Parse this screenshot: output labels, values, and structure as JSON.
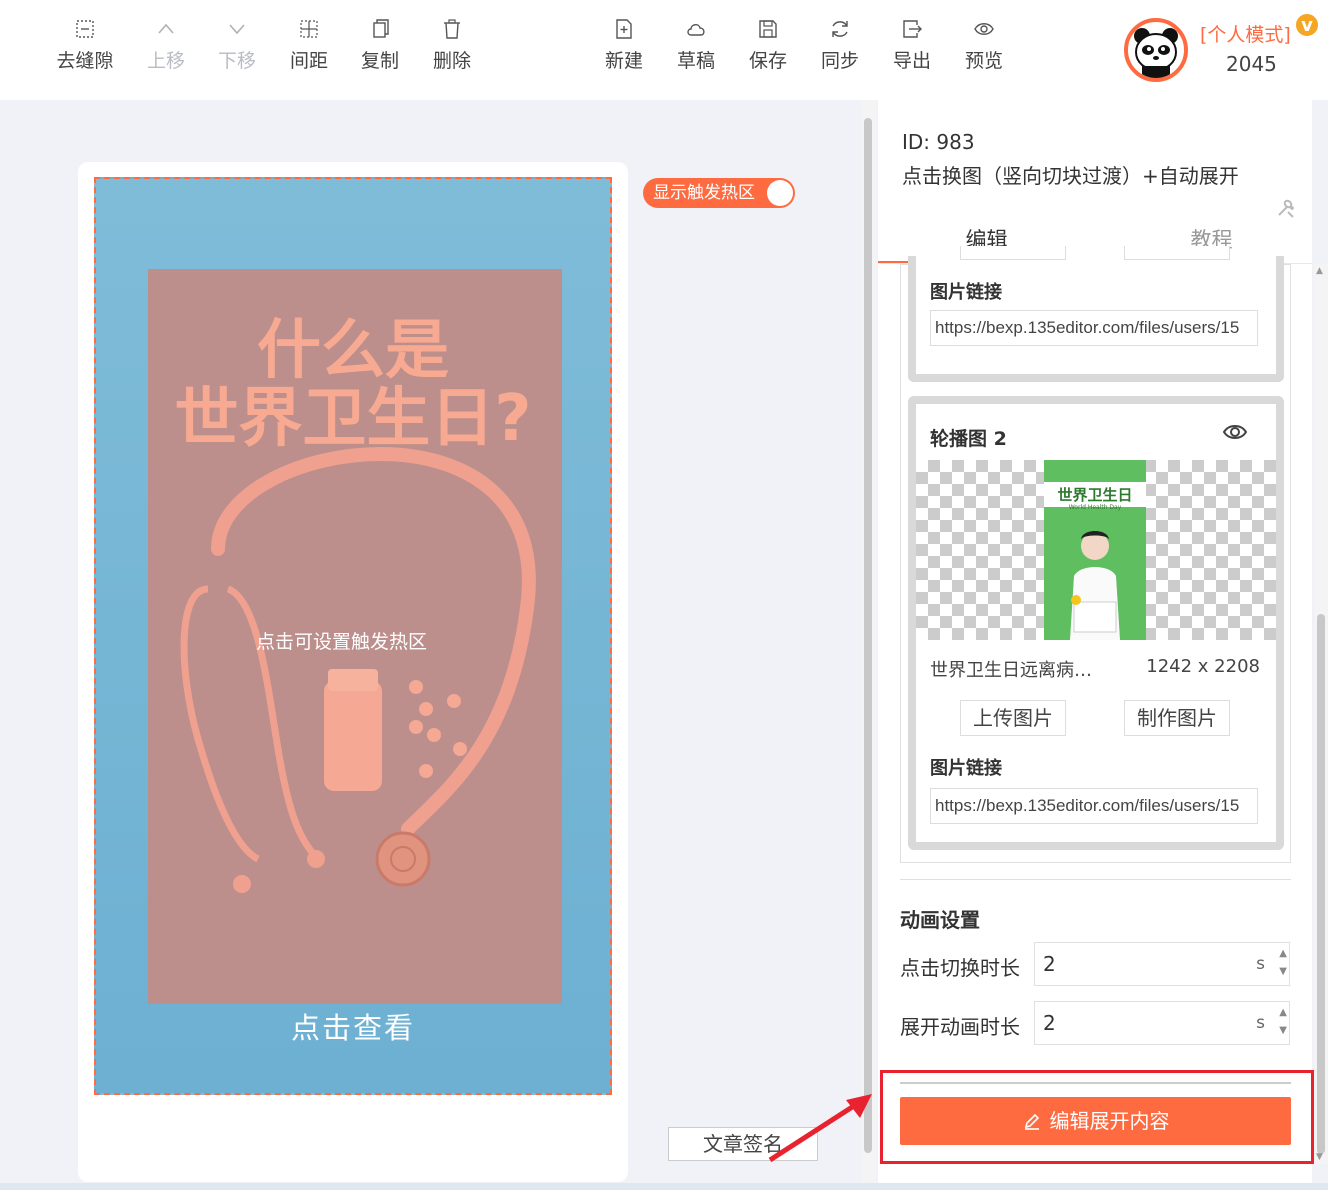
{
  "toolbar": {
    "left_group": [
      {
        "label": "去缝隙",
        "icon": "gap-icon",
        "disabled": false
      },
      {
        "label": "上移",
        "icon": "chevron-up-icon",
        "disabled": true
      },
      {
        "label": "下移",
        "icon": "chevron-down-icon",
        "disabled": true
      },
      {
        "label": "间距",
        "icon": "spacing-icon",
        "disabled": false
      },
      {
        "label": "复制",
        "icon": "copy-icon",
        "disabled": false
      },
      {
        "label": "删除",
        "icon": "trash-icon",
        "disabled": false
      }
    ],
    "right_group": [
      {
        "label": "新建",
        "icon": "new-file-icon"
      },
      {
        "label": "草稿",
        "icon": "cloud-icon"
      },
      {
        "label": "保存",
        "icon": "save-icon"
      },
      {
        "label": "同步",
        "icon": "sync-icon"
      },
      {
        "label": "导出",
        "icon": "export-icon"
      },
      {
        "label": "预览",
        "icon": "eye-icon"
      }
    ]
  },
  "user": {
    "mode": "[个人模式]",
    "vip_badge": "v",
    "id": "2045"
  },
  "canvas": {
    "toggle_label": "显示触发热区",
    "title_line1": "什么是",
    "title_line2": "世界卫生日?",
    "hotzone_hint": "点击可设置触发热区",
    "see_more": "点击查看",
    "signature": "文章签名"
  },
  "panel": {
    "id_label": "ID: 983",
    "component_name": "点击换图（竖向切块过渡）+自动展开",
    "tabs": [
      "编辑",
      "教程"
    ],
    "slide1": {
      "link_label": "图片链接",
      "link_value": "https://bexp.135editor.com/files/users/15"
    },
    "slide2": {
      "title": "轮播图 2",
      "thumb_title": "世界卫生日",
      "thumb_sub": "World Health Day",
      "file_name": "世界卫生日远离病…",
      "dimensions": "1242 x 2208",
      "upload_button": "上传图片",
      "make_button": "制作图片",
      "link_label": "图片链接",
      "link_value": "https://bexp.135editor.com/files/users/15"
    },
    "animation": {
      "title": "动画设置",
      "switch_label": "点击切换时长",
      "switch_value": "2",
      "expand_label": "展开动画时长",
      "expand_value": "2",
      "unit": "s"
    },
    "edit_expand_button": "编辑展开内容"
  },
  "colors": {
    "accent": "#ff6b40",
    "highlight_box": "#e8232f",
    "hero_bg": "#7fbcd8",
    "card_bg": "#bc8f8c",
    "title_color": "#f7aa91"
  }
}
